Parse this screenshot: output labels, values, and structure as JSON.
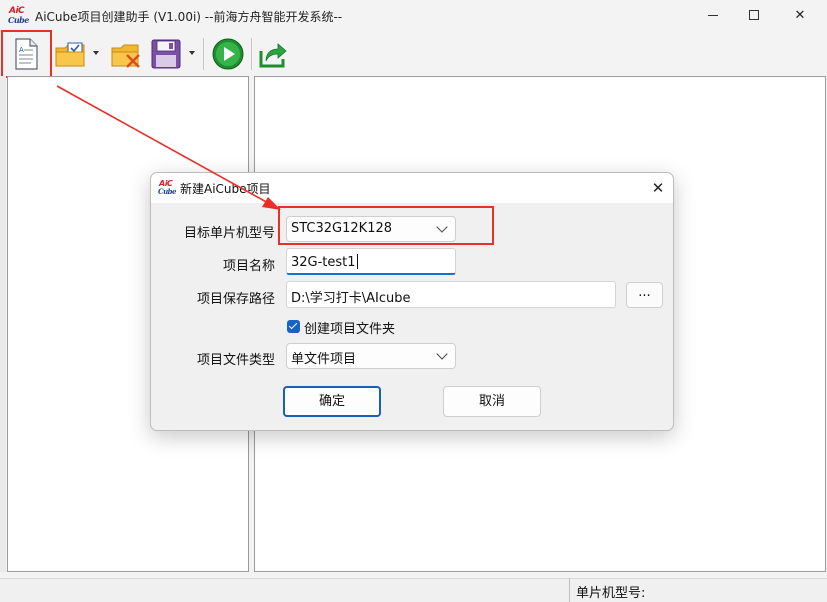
{
  "window": {
    "title": "AiCube项目创建助手 (V1.00i) --前海方舟智能开发系统--",
    "logo_top": "AiC",
    "logo_bottom": "Cube"
  },
  "toolbar": {
    "items": [
      {
        "icon": "new-document-icon"
      },
      {
        "icon": "open-folder-check-icon"
      },
      {
        "icon": "close-folder-icon"
      },
      {
        "icon": "save-disk-icon"
      },
      {
        "icon": "run-play-icon"
      },
      {
        "icon": "export-share-icon"
      }
    ]
  },
  "statusbar": {
    "mcu_label": "单片机型号:"
  },
  "dialog": {
    "title": "新建AiCube项目",
    "logo_top": "AiC",
    "logo_bottom": "Cube",
    "fields": {
      "mcu_label": "目标单片机型号",
      "mcu_value": "STC32G12K128",
      "name_label": "项目名称",
      "name_value": "32G-test1",
      "path_label": "项目保存路径",
      "path_value": "D:\\学习打卡\\AIcube",
      "browse_label": "...",
      "create_folder_label": "创建项目文件夹",
      "create_folder_checked": true,
      "type_label": "项目文件类型",
      "type_value": "单文件项目"
    },
    "ok_label": "确定",
    "cancel_label": "取消"
  },
  "colors": {
    "annotation_red": "#e8302a",
    "accent_blue": "#1a62c0"
  }
}
